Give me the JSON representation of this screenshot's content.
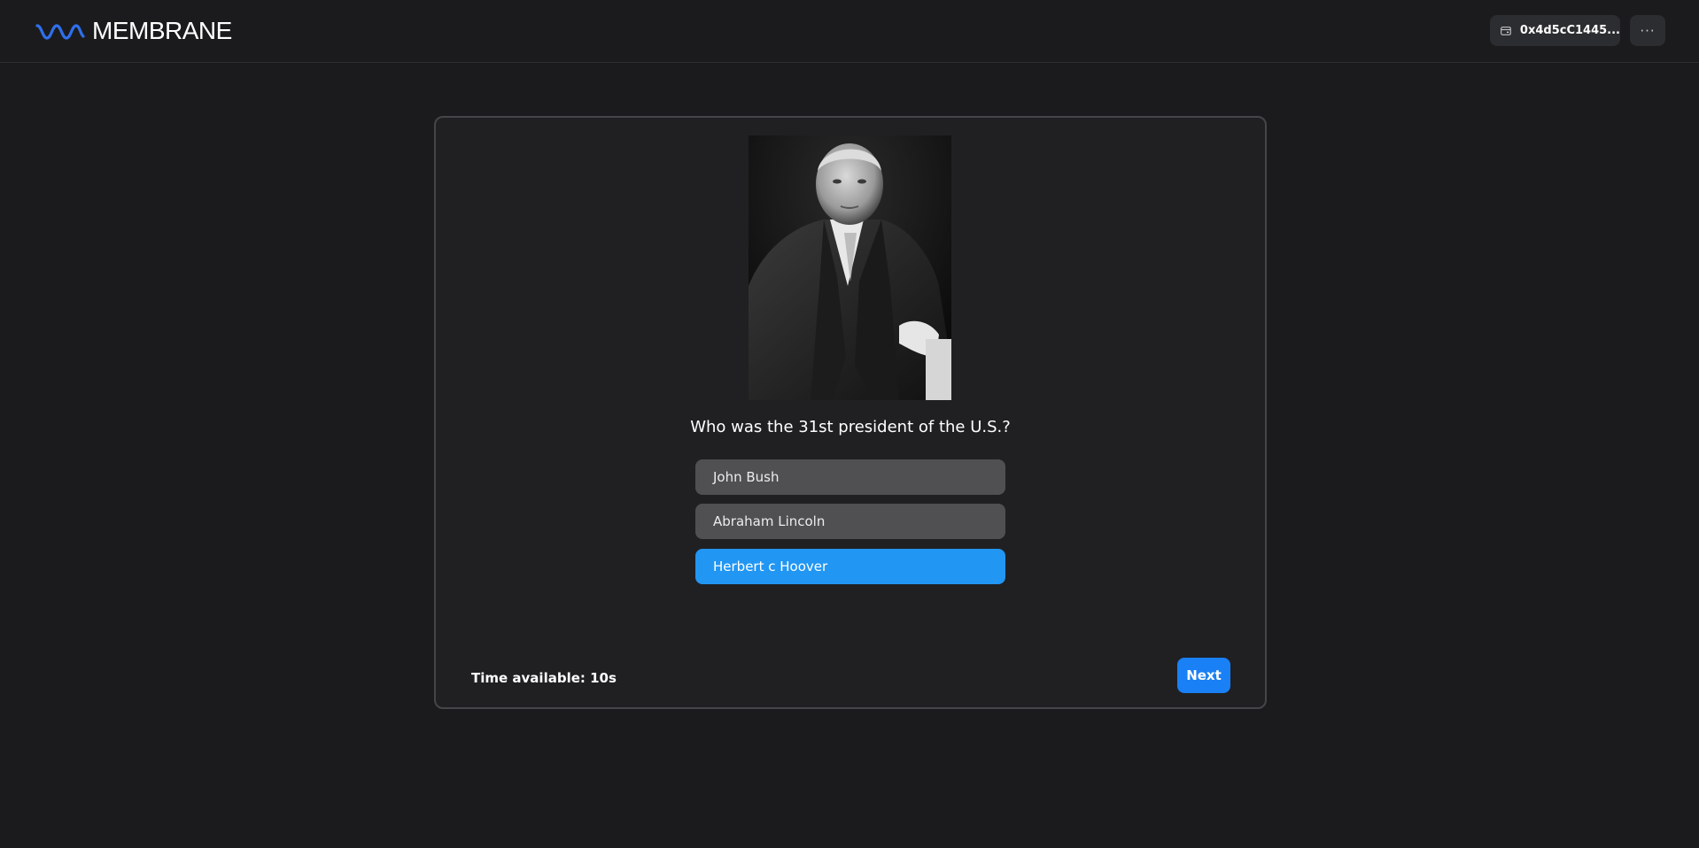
{
  "header": {
    "brand_name": "MEMBRANE",
    "brand_icon": "wave-logo-icon",
    "wallet_icon": "wallet-icon",
    "wallet_address": "0x4d5cC1445...",
    "more_label": "···"
  },
  "quiz": {
    "image_subject": "portrait-photo",
    "question": "Who was the 31st president of the U.S.?",
    "answers": [
      {
        "label": "John Bush",
        "selected": false
      },
      {
        "label": "Abraham Lincoln",
        "selected": false
      },
      {
        "label": "Herbert c Hoover",
        "selected": true
      }
    ],
    "timer_text": "Time available: 10s",
    "next_label": "Next"
  },
  "colors": {
    "background": "#1b1b1d",
    "card": "#202023",
    "accent": "#1a80f5",
    "selected_answer": "#2196f3",
    "answer": "#505053",
    "logo": "#2f6fea"
  }
}
